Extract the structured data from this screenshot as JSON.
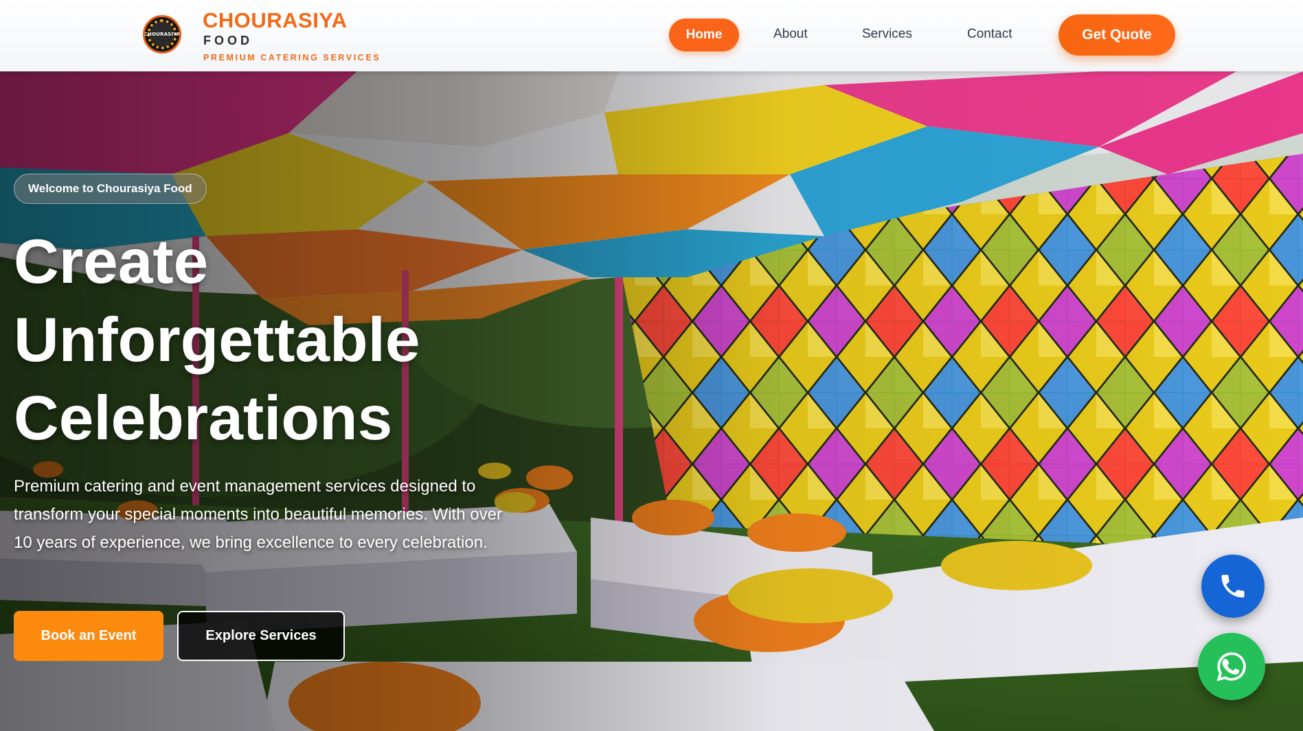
{
  "brand": {
    "badge_text": "CHOURASIYA",
    "name": "CHOURASIYA",
    "sub": "FOOD",
    "tagline": "PREMIUM CATERING SERVICES"
  },
  "nav": {
    "home": "Home",
    "about": "About",
    "services": "Services",
    "contact": "Contact",
    "quote": "Get Quote"
  },
  "hero": {
    "welcome": "Welcome to Chourasiya Food",
    "title_lines": [
      "Create",
      "Unforgettable",
      "Celebrations"
    ],
    "description": "Premium catering and event management services designed to transform your special moments into beautiful memories. With over 10 years of experience, we bring excellence to every celebration.",
    "book_button": "Book an Event",
    "explore_button": "Explore Services"
  },
  "floating": {
    "phone_icon": "phone-icon",
    "whatsapp_icon": "whatsapp-icon"
  },
  "colors": {
    "accent": "#f96418",
    "book": "#fb8a0f",
    "phone": "#1565d6",
    "whatsapp": "#26c05a"
  }
}
